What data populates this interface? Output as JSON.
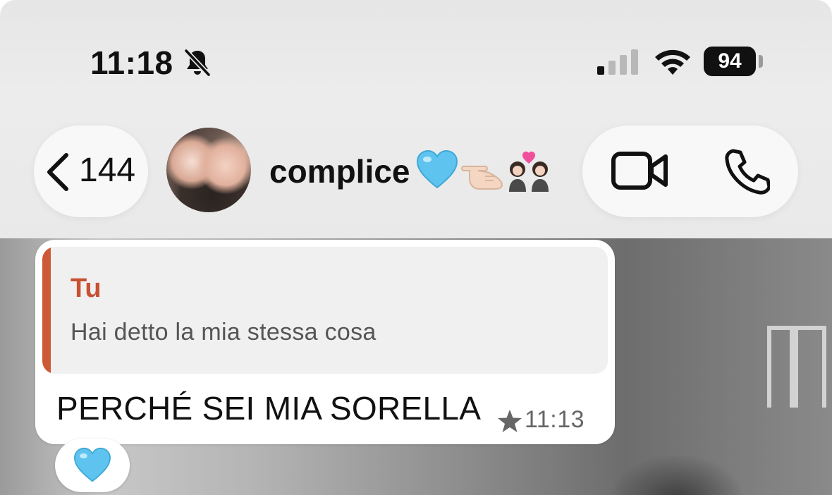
{
  "status_bar": {
    "time": "11:18",
    "battery": "94",
    "icons": [
      "bell-slash-icon",
      "cellular-signal-icon",
      "wifi-icon",
      "battery-icon"
    ]
  },
  "nav": {
    "back_count": "144",
    "contact_name": "complice",
    "name_emojis": [
      "blue-heart",
      "pointing-hand",
      "two-women-with-heart"
    ],
    "actions": [
      "video-call",
      "voice-call"
    ]
  },
  "message": {
    "quote_author": "Tu",
    "quote_text": "Hai detto la mia stessa cosa",
    "text": "PERCHÉ SEI MIA SORELLA",
    "time": "11:13",
    "starred": true,
    "reaction": "blue-heart"
  },
  "colors": {
    "quote_accent": "#cc5a36",
    "quote_author": "#c85131",
    "heart": "#5ec3ee"
  }
}
